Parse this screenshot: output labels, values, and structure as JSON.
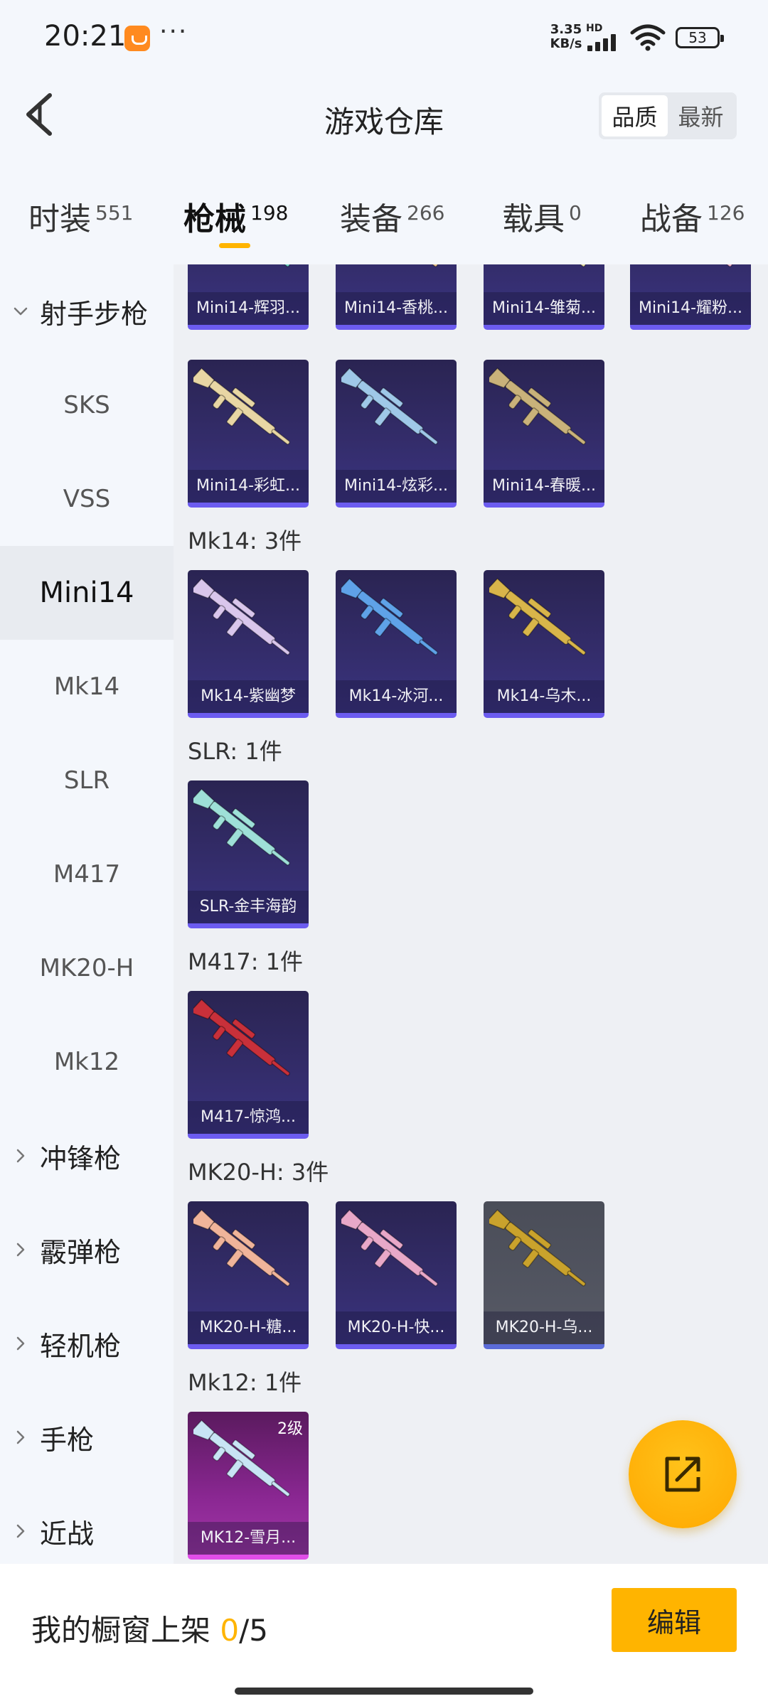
{
  "status_bar": {
    "time": "20:21",
    "more": "···",
    "net_speed": "3.35 KB/s",
    "hd": "HD",
    "battery": "53"
  },
  "header": {
    "title": "游戏仓库",
    "sort_options": [
      "品质",
      "最新"
    ],
    "sort_selected": "品质"
  },
  "tabs": [
    {
      "label": "时装",
      "count": "551"
    },
    {
      "label": "枪械",
      "count": "198",
      "active": true
    },
    {
      "label": "装备",
      "count": "266"
    },
    {
      "label": "载具",
      "count": "0"
    },
    {
      "label": "战备",
      "count": "126"
    }
  ],
  "sidebar": {
    "items": [
      {
        "label": "射手步枪",
        "group": true,
        "expanded": true
      },
      {
        "label": "SKS"
      },
      {
        "label": "VSS"
      },
      {
        "label": "Mini14",
        "active": true
      },
      {
        "label": "Mk14"
      },
      {
        "label": "SLR"
      },
      {
        "label": "M417"
      },
      {
        "label": "MK20-H"
      },
      {
        "label": "Mk12"
      },
      {
        "label": "冲锋枪",
        "group": true
      },
      {
        "label": "霰弹枪",
        "group": true
      },
      {
        "label": "轻机枪",
        "group": true
      },
      {
        "label": "手枪",
        "group": true
      },
      {
        "label": "近战",
        "group": true
      }
    ]
  },
  "sections": [
    {
      "heading": "",
      "items": [
        {
          "label": "Mini14-辉羽...",
          "gun_color": "#6fd3c7"
        },
        {
          "label": "Mini14-香桃...",
          "gun_color": "#e9c08a"
        },
        {
          "label": "Mini14-雏菊...",
          "gun_color": "#e8e0a8"
        },
        {
          "label": "Mini14-耀粉...",
          "gun_color": "#f0b4d0"
        },
        {
          "label": "Mini14-彩虹...",
          "gun_color": "#e8d6a4"
        },
        {
          "label": "Mini14-炫彩...",
          "gun_color": "#9fc8e8"
        },
        {
          "label": "Mini14-春暖...",
          "gun_color": "#c9b27a"
        }
      ]
    },
    {
      "heading": "Mk14: 3件",
      "items": [
        {
          "label": "Mk14-紫幽梦",
          "gun_color": "#d9c6ec"
        },
        {
          "label": "Mk14-冰河...",
          "gun_color": "#5fa2e8"
        },
        {
          "label": "Mk14-乌木...",
          "gun_color": "#d8b54a"
        }
      ]
    },
    {
      "heading": "SLR: 1件",
      "items": [
        {
          "label": "SLR-金丰海韵",
          "gun_color": "#9ee0d8"
        }
      ]
    },
    {
      "heading": "M417: 1件",
      "items": [
        {
          "label": "M417-惊鸿...",
          "gun_color": "#c8303a"
        }
      ]
    },
    {
      "heading": "MK20-H: 3件",
      "items": [
        {
          "label": "MK20-H-糖...",
          "gun_color": "#f0b49a"
        },
        {
          "label": "MK20-H-快...",
          "gun_color": "#e8a8c8"
        },
        {
          "label": "MK20-H-乌...",
          "gun_color": "#c9a22c",
          "style": "grey"
        }
      ]
    },
    {
      "heading": "Mk12: 1件",
      "items": [
        {
          "label": "MK12-雪月...",
          "gun_color": "#c8e4f4",
          "style": "pink",
          "level": "2级"
        }
      ]
    }
  ],
  "fab": {
    "icon": "share-external-icon"
  },
  "bottom_bar": {
    "label": "我的橱窗上架",
    "shelf_current": "0",
    "shelf_total": "/5",
    "edit_label": "编辑"
  },
  "colors": {
    "accent": "#ffb400",
    "card_purple": "#342d6c",
    "card_border": "#6c5cf0",
    "card_pink": "#a236a8",
    "page_bg": "#eef0f4"
  }
}
